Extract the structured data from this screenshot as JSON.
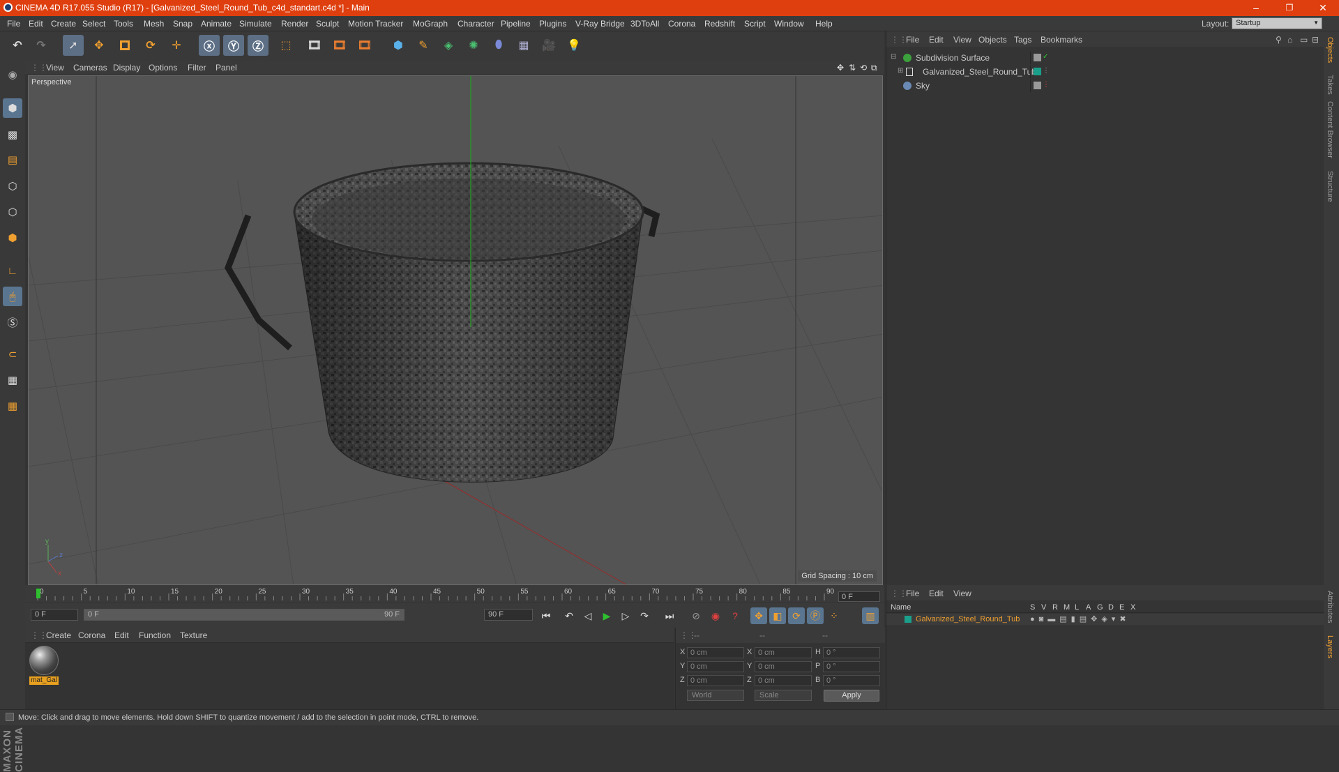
{
  "window": {
    "title": "CINEMA 4D R17.055 Studio (R17) - [Galvanized_Steel_Round_Tub_c4d_standart.c4d *] - Main",
    "min": "–",
    "max": "❐",
    "close": "✕"
  },
  "menu": [
    "File",
    "Edit",
    "Create",
    "Select",
    "Tools",
    "Mesh",
    "Snap",
    "Animate",
    "Simulate",
    "Render",
    "Sculpt",
    "Motion Tracker",
    "MoGraph",
    "Character",
    "Pipeline",
    "Plugins",
    "V-Ray Bridge",
    "3DToAll",
    "Corona",
    "Redshift",
    "Script",
    "Window",
    "Help"
  ],
  "layout": {
    "label": "Layout:",
    "value": "Startup"
  },
  "viewport": {
    "menu": [
      "View",
      "Cameras",
      "Display",
      "Options",
      "Filter",
      "Panel"
    ],
    "label": "Perspective",
    "grid_spacing": "Grid Spacing : 10 cm"
  },
  "timeline": {
    "ticks": [
      "0",
      "5",
      "10",
      "15",
      "20",
      "25",
      "30",
      "35",
      "40",
      "45",
      "50",
      "55",
      "60",
      "65",
      "70",
      "75",
      "80",
      "85",
      "90"
    ],
    "current_frame": "0 F",
    "start_field": "0 F",
    "range_start": "0 F",
    "range_end": "90 F",
    "end_field": "90 F"
  },
  "material_menu": [
    "Create",
    "Corona",
    "Edit",
    "Function",
    "Texture"
  ],
  "material": {
    "name": "mat_Gal"
  },
  "coords": {
    "headers": [
      "--",
      "--",
      "--"
    ],
    "pos": {
      "x": "0 cm",
      "y": "0 cm",
      "z": "0 cm"
    },
    "size": {
      "x": "0 cm",
      "y": "0 cm",
      "z": "0 cm"
    },
    "rot": {
      "h": "0 °",
      "p": "0 °",
      "b": "0 °"
    },
    "axis_labels": {
      "x": "X",
      "y": "Y",
      "z": "Z",
      "h": "H",
      "p": "P",
      "b": "B"
    },
    "mode": "World",
    "scale": "Scale",
    "apply": "Apply"
  },
  "objects": {
    "menu": [
      "File",
      "Edit",
      "View",
      "Objects",
      "Tags",
      "Bookmarks"
    ],
    "items": [
      {
        "name": "Subdivision Surface",
        "color": "#3ca03c"
      },
      {
        "name": "Galvanized_Steel_Round_Tub",
        "color": "#aaaaaa"
      },
      {
        "name": "Sky",
        "color": "#6a8ab5"
      }
    ]
  },
  "layers": {
    "menu": [
      "File",
      "Edit",
      "View"
    ],
    "header_name": "Name",
    "columns": [
      "S",
      "V",
      "R",
      "M",
      "L",
      "A",
      "G",
      "D",
      "E",
      "X"
    ],
    "row_name": "Galvanized_Steel_Round_Tub",
    "row_color": "#1aa08a"
  },
  "side_tabs": [
    "Objects",
    "Takes",
    "Content Browser",
    "Structure",
    "Attributes",
    "Layers"
  ],
  "status": "Move: Click and drag to move elements. Hold down SHIFT to quantize movement / add to the selection in point mode, CTRL to remove.",
  "logo": "MAXON CINEMA 4D",
  "colors": {
    "titlebar": "#df3f0f",
    "accent": "#f0a030",
    "selected_tool": "#5d6f85"
  }
}
